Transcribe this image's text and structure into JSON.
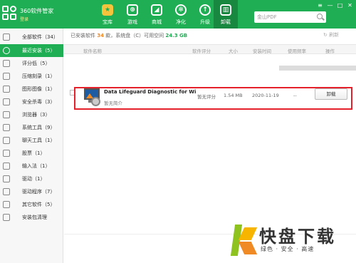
{
  "app": {
    "title": "360软件管家",
    "subtitle": "登录"
  },
  "nav": [
    {
      "label": "宝库",
      "icon": "star-icon"
    },
    {
      "label": "游戏",
      "icon": "gamepad-icon"
    },
    {
      "label": "商城",
      "icon": "shop-icon"
    },
    {
      "label": "净化",
      "icon": "purify-icon"
    },
    {
      "label": "升级",
      "icon": "upgrade-icon"
    },
    {
      "label": "卸载",
      "icon": "trash-icon"
    }
  ],
  "search": {
    "placeholder": "金山PDF"
  },
  "window": {
    "minimize": "—",
    "maximize": "□",
    "close": "✕",
    "menu": "≡"
  },
  "sidebar": [
    {
      "label": "全部软件（34）"
    },
    {
      "label": "最近安装（5）"
    },
    {
      "label": "评分低（5）"
    },
    {
      "label": "压缩刻录（1）"
    },
    {
      "label": "图形图像（1）"
    },
    {
      "label": "安全杀毒（3）"
    },
    {
      "label": "浏览器（3）"
    },
    {
      "label": "系统工具（9）"
    },
    {
      "label": "聊天工具（1）"
    },
    {
      "label": "股票（1）"
    },
    {
      "label": "输入法（1）"
    },
    {
      "label": "驱动（1）"
    },
    {
      "label": "驱动程序（7）"
    },
    {
      "label": "其它软件（5）"
    },
    {
      "label": "安装包清理"
    }
  ],
  "summary": {
    "prefix": "已安装软件",
    "count": "34",
    "middle": "款，系统盘（C）可用空间",
    "space": "24.3 GB"
  },
  "refresh_label": "刷新",
  "columns": [
    "软件名称",
    "软件评分",
    "大小",
    "安装时间",
    "使用频率",
    "操作"
  ],
  "software": {
    "name": "Data Lifeguard Diagnostic for Wi",
    "desc": "暂无简介",
    "rating": "暂无评分",
    "size": "1.54 MB",
    "install_date": "2020-11-19",
    "frequency": "--",
    "action": "卸载"
  },
  "watermark": {
    "title": "快盘下载",
    "subtitle": "绿色 · 安全 · 高速"
  },
  "colors": {
    "brand": "#1fae53",
    "highlight": "#e5222b",
    "accent": "#f08a24"
  }
}
